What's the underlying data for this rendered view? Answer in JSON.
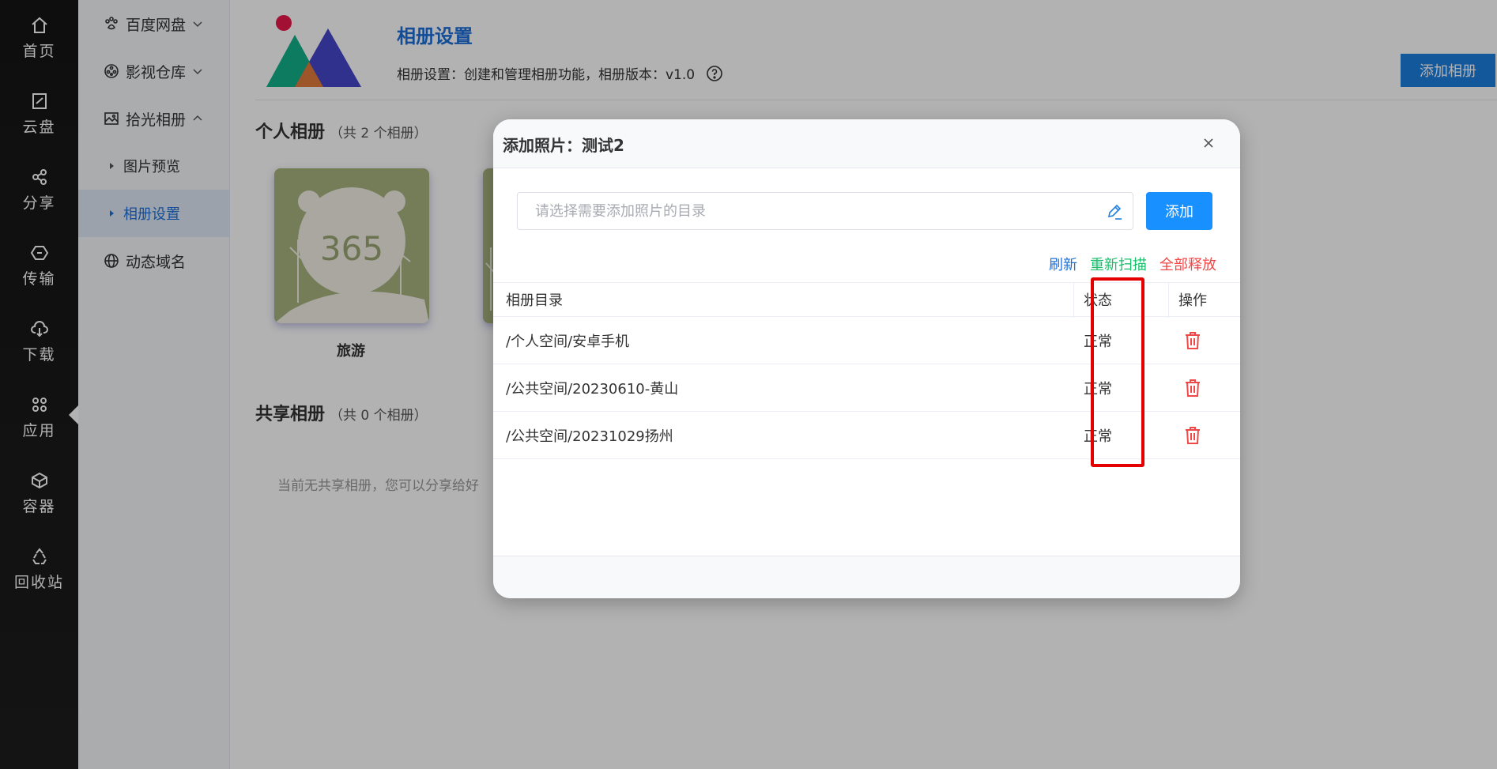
{
  "rail": {
    "items": [
      {
        "label": "首页",
        "icon": "home-icon"
      },
      {
        "label": "云盘",
        "icon": "cloud-disk-icon"
      },
      {
        "label": "分享",
        "icon": "share-icon"
      },
      {
        "label": "传输",
        "icon": "transfer-icon"
      },
      {
        "label": "下载",
        "icon": "cloud-download-icon"
      },
      {
        "label": "应用",
        "icon": "apps-icon"
      },
      {
        "label": "容器",
        "icon": "container-icon"
      },
      {
        "label": "回收站",
        "icon": "recycle-icon"
      }
    ]
  },
  "subnav": {
    "items": [
      {
        "label": "百度网盘",
        "icon": "paw-icon"
      },
      {
        "label": "影视仓库",
        "icon": "film-reel-icon"
      },
      {
        "label": "拾光相册",
        "icon": "image-icon"
      },
      {
        "label": "动态域名",
        "icon": "globe-icon"
      }
    ],
    "children": [
      {
        "label": "图片预览"
      },
      {
        "label": "相册设置"
      }
    ]
  },
  "header": {
    "title": "相册设置",
    "description": "相册设置：创建和管理相册功能，相册版本：v1.0",
    "add_album_label": "添加相册"
  },
  "personal": {
    "title": "个人相册",
    "count": "（共 2 个相册）",
    "albums": [
      {
        "name": "旅游",
        "cover_text": "365"
      }
    ]
  },
  "shared": {
    "title": "共享相册",
    "count": "（共 0 个相册）",
    "empty_text": "当前无共享相册，您可以分享给好"
  },
  "dialog": {
    "title": "添加照片：测试2",
    "input_placeholder": "请选择需要添加照片的目录",
    "add_label": "添加",
    "actions": {
      "refresh": "刷新",
      "rescan": "重新扫描",
      "release_all": "全部释放"
    },
    "columns": {
      "dir": "相册目录",
      "status": "状态",
      "op": "操作"
    },
    "rows": [
      {
        "dir": "/个人空间/安卓手机",
        "status": "正常"
      },
      {
        "dir": "/公共空间/20230610-黄山",
        "status": "正常"
      },
      {
        "dir": "/公共空间/20231029扬州",
        "status": "正常"
      }
    ]
  },
  "colors": {
    "accent": "#1e6fd9",
    "primary_button": "#1890ff",
    "rescan": "#19be6b",
    "danger": "#f04848",
    "highlight": "#e50000"
  }
}
